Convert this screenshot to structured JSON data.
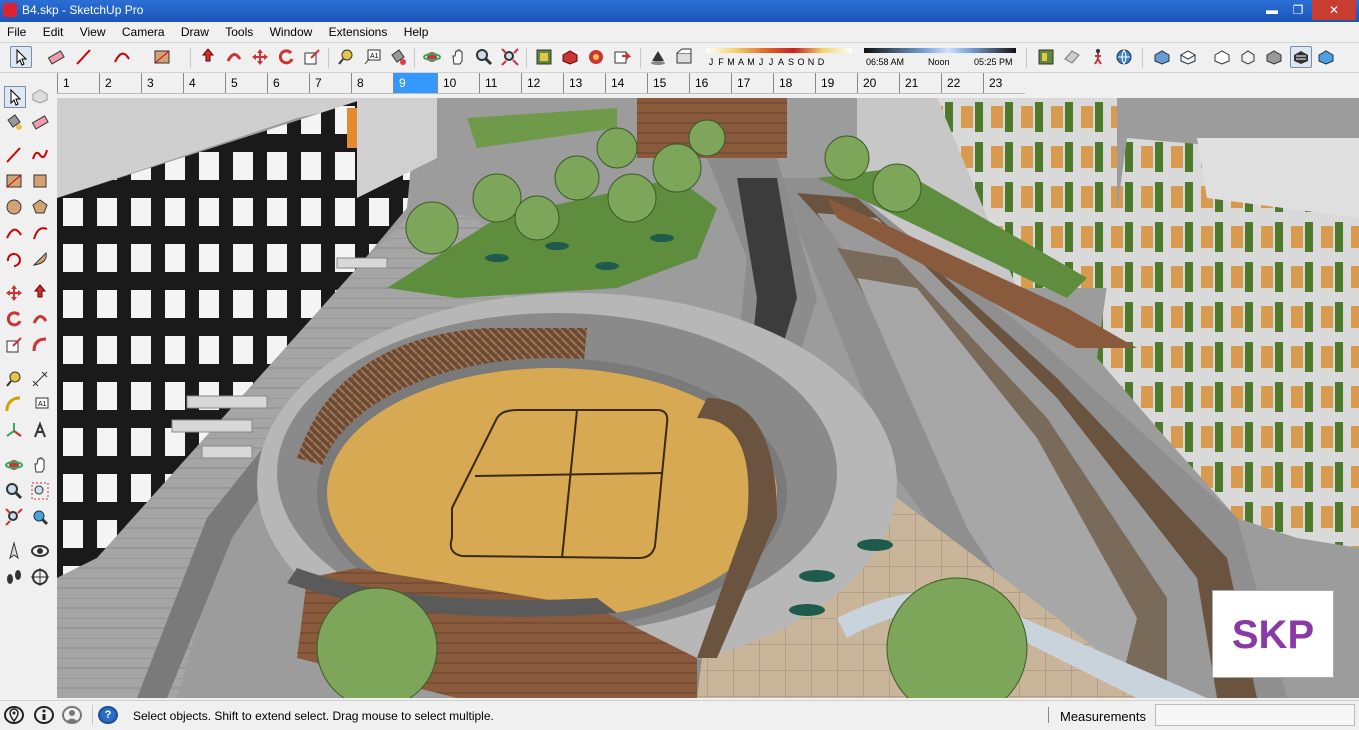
{
  "window": {
    "title": "B4.skp - SketchUp Pro",
    "minimize": "▬",
    "maximize": "❐",
    "close": "✕"
  },
  "menu": [
    "File",
    "Edit",
    "View",
    "Camera",
    "Draw",
    "Tools",
    "Window",
    "Extensions",
    "Help"
  ],
  "shadow": {
    "months": [
      "J",
      "F",
      "M",
      "A",
      "M",
      "J",
      "J",
      "A",
      "S",
      "O",
      "N",
      "D"
    ],
    "time_start": "06:58 AM",
    "time_mid": "Noon",
    "time_end": "05:25 PM"
  },
  "scenes": [
    "1",
    "2",
    "3",
    "4",
    "5",
    "6",
    "7",
    "8",
    "9",
    "10",
    "11",
    "12",
    "13",
    "14",
    "15",
    "16",
    "17",
    "18",
    "19",
    "20",
    "21",
    "22",
    "23"
  ],
  "active_scene": "9",
  "status": {
    "message": "Select objects. Shift to extend select. Drag mouse to select multiple.",
    "measurements_label": "Measurements",
    "measurements_value": "",
    "help_icon": "?"
  },
  "watermark": "SKP"
}
